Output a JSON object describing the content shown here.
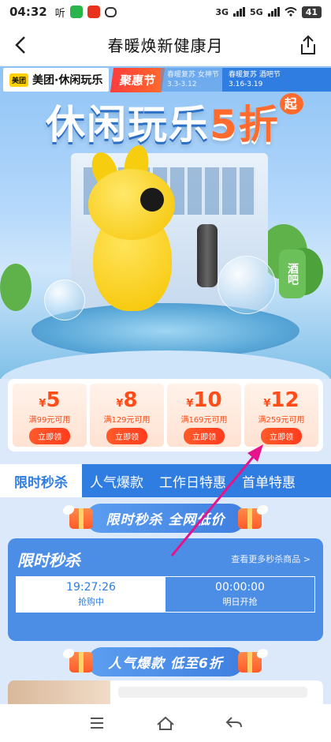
{
  "status_bar": {
    "time": "04:32",
    "app_label": "听",
    "network1": "3G",
    "network2": "5G",
    "battery": "41"
  },
  "nav": {
    "title": "春暖焕新健康月",
    "back_icon": "chevron-left-icon",
    "share_icon": "share-icon"
  },
  "hero": {
    "brand_logo": "美团",
    "brand_text": "美团·休闲玩乐",
    "promo_tag": "聚惠节",
    "phase1_title": "春暖复苏 女神节",
    "phase1_dates": "3.3-3.12",
    "phase2_title": "春暖复苏 酒吧节",
    "phase2_dates": "3.16-3.19",
    "headline_main": "休闲玩乐",
    "headline_accent": "5折",
    "headline_suffix": "起",
    "pub_sign": "酒吧"
  },
  "coupons": [
    {
      "currency": "¥",
      "amount": "5",
      "condition": "满99元可用",
      "button": "立即领"
    },
    {
      "currency": "¥",
      "amount": "8",
      "condition": "满129元可用",
      "button": "立即领"
    },
    {
      "currency": "¥",
      "amount": "10",
      "condition": "满169元可用",
      "button": "立即领"
    },
    {
      "currency": "¥",
      "amount": "12",
      "condition": "满259元可用",
      "button": "立即领"
    }
  ],
  "tabs": [
    {
      "label": "限时秒杀",
      "active": true
    },
    {
      "label": "人气爆款",
      "active": false
    },
    {
      "label": "工作日特惠",
      "active": false
    },
    {
      "label": "首单特惠",
      "active": false
    }
  ],
  "section1": {
    "label": "限时秒杀 全网低价"
  },
  "flash_sale": {
    "title": "限时秒杀",
    "more_link": "查看更多秒杀商品 >",
    "slots": [
      {
        "time": "19:27:26",
        "status": "抢购中",
        "active": true
      },
      {
        "time": "00:00:00",
        "status": "明日开抢",
        "active": false
      }
    ]
  },
  "section2": {
    "label": "人气爆款 低至6折"
  },
  "colors": {
    "primary_blue": "#2f7de0",
    "coupon_red": "#ff4d1a",
    "annotation_arrow": "#e6148c"
  }
}
